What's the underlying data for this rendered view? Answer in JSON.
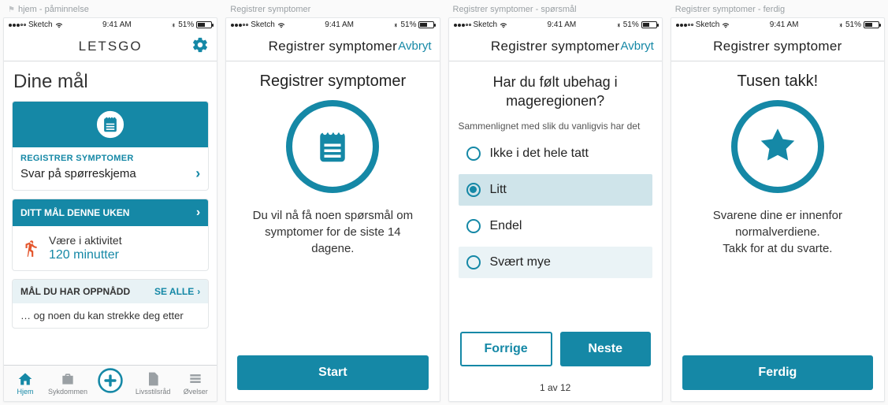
{
  "screens": [
    {
      "label": "hjem - påminnelse"
    },
    {
      "label": "Registrer symptomer"
    },
    {
      "label": "Registrer symptomer - spørsmål"
    },
    {
      "label": "Registrer symptomer - ferdig"
    }
  ],
  "statusbar": {
    "carrier": "Sketch",
    "time": "9:41 AM",
    "battery_pct": "51%"
  },
  "home": {
    "app_title": "LETSGO",
    "section_title": "Dine mål",
    "reminder": {
      "eyebrow": "REGISTRER SYMPTOMER",
      "line": "Svar på spørreskjema"
    },
    "goal": {
      "header": "DITT MÅL DENNE UKEN",
      "line1": "Være i aktivitet",
      "line2": "120 minutter"
    },
    "achieved": {
      "header": "MÅL DU HAR OPPNÅDD",
      "see_all": "SE ALLE",
      "line": "… og noen du kan strekke deg etter"
    },
    "tabs": [
      "Hjem",
      "Sykdommen",
      "",
      "Livsstilsråd",
      "Øvelser"
    ]
  },
  "intro": {
    "nav_title": "Registrer symptomer",
    "nav_cancel": "Avbryt",
    "heading": "Registrer symptomer",
    "desc": "Du vil nå få noen spørsmål om symptomer for de siste 14 dagene.",
    "cta": "Start"
  },
  "question": {
    "nav_title": "Registrer symptomer",
    "nav_cancel": "Avbryt",
    "heading": "Har du følt ubehag i mageregionen?",
    "sub": "Sammenlignet med slik du vanligvis har det",
    "options": [
      "Ikke i det hele tatt",
      "Litt",
      "Endel",
      "Svært mye"
    ],
    "selected_index": 1,
    "prev": "Forrige",
    "next": "Neste",
    "pager": "1 av 12"
  },
  "done": {
    "nav_title": "Registrer symptomer",
    "heading": "Tusen takk!",
    "desc1": "Svarene dine er innenfor normalverdiene.",
    "desc2": "Takk for at du svarte.",
    "cta": "Ferdig"
  }
}
